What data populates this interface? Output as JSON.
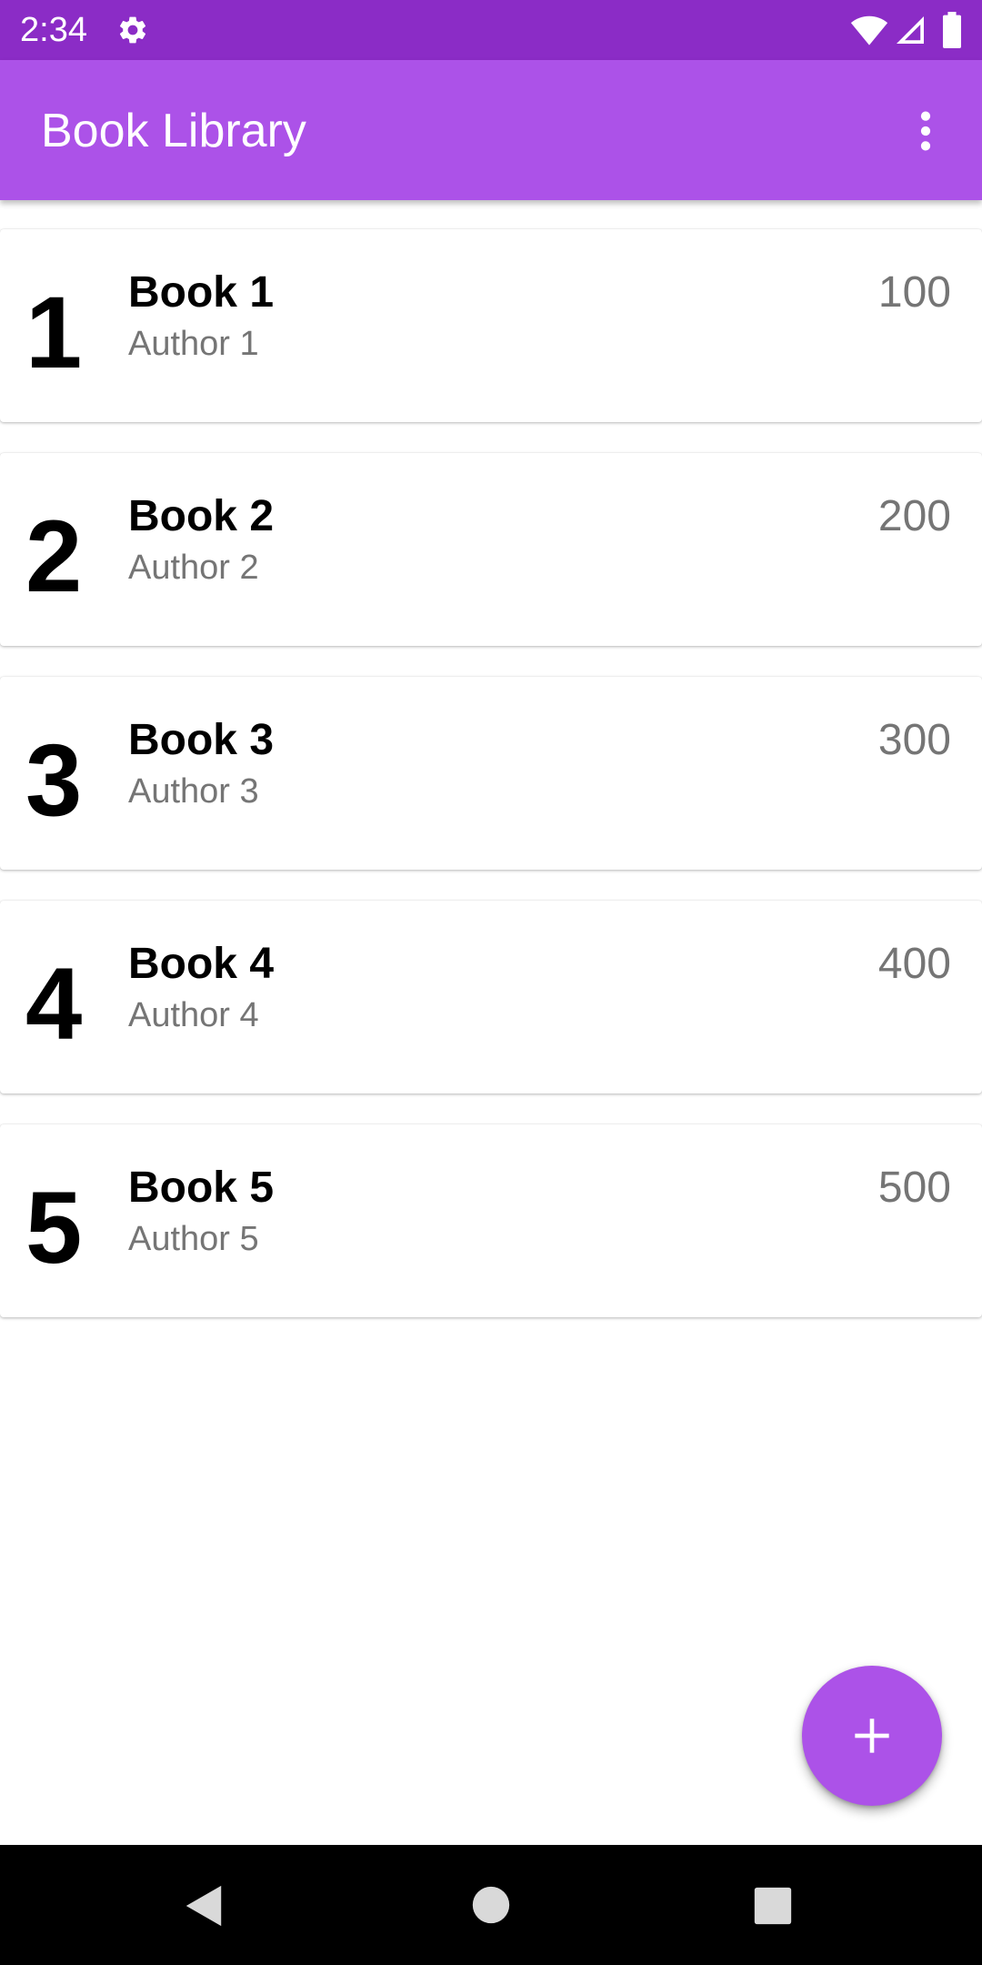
{
  "status_bar": {
    "time": "2:34",
    "settings_icon": "gear-icon",
    "wifi_icon": "wifi-icon",
    "signal_icon": "cell-signal-icon",
    "battery_icon": "battery-icon"
  },
  "app_bar": {
    "title": "Book Library",
    "overflow_icon": "more-vert-icon"
  },
  "books": [
    {
      "number": "1",
      "title": "Book 1",
      "author": "Author 1",
      "pages": "100"
    },
    {
      "number": "2",
      "title": "Book 2",
      "author": "Author 2",
      "pages": "200"
    },
    {
      "number": "3",
      "title": "Book 3",
      "author": "Author 3",
      "pages": "300"
    },
    {
      "number": "4",
      "title": "Book 4",
      "author": "Author 4",
      "pages": "400"
    },
    {
      "number": "5",
      "title": "Book 5",
      "author": "Author 5",
      "pages": "500"
    }
  ],
  "fab": {
    "icon": "plus-icon"
  },
  "nav_bar": {
    "back_icon": "back-triangle-icon",
    "home_icon": "home-circle-icon",
    "recents_icon": "recents-square-icon"
  },
  "colors": {
    "status_bar": "#8b2cc6",
    "app_bar": "#ac52e8",
    "accent": "#ac52e8",
    "secondary_text": "#757575"
  }
}
